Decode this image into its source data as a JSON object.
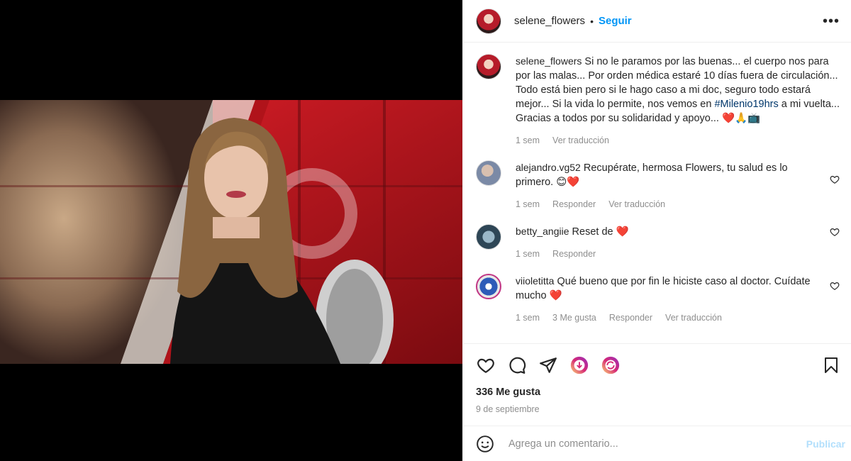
{
  "post": {
    "username": "selene_flowers",
    "follow_label": "Seguir",
    "more_label": "•••",
    "caption": "Si no le paramos por las buenas... el cuerpo nos para por las malas... Por orden médica estaré 10 días fuera de circulación... Todo está bien pero si le hago caso a mi doc, seguro todo estará mejor... Si la vida lo permite, nos vemos en",
    "caption_hashtag": "#Milenio19hrs",
    "caption_end": "a mi vuelta... Gracias a todos por su solidaridad y apoyo...",
    "caption_emojis": "❤️🙏📺",
    "caption_time": "1 sem",
    "caption_translate": "Ver traducción",
    "likes": "336 Me gusta",
    "date": "9 de septiembre"
  },
  "comments": [
    {
      "username": "alejandro.vg52",
      "text": "Recupérate, hermosa Flowers, tu salud es lo primero.",
      "emojis": "😊❤️",
      "time": "1 sem",
      "reply": "Responder",
      "translate": "Ver traducción"
    },
    {
      "username": "betty_angiie",
      "text": "Reset de",
      "emojis": "❤️",
      "time": "1 sem",
      "reply": "Responder"
    },
    {
      "username": "viioletitta",
      "text": "Qué bueno que por fin le hiciste caso al doctor. Cuídate mucho",
      "emojis": "❤️",
      "time": "1 sem",
      "likes": "3 Me gusta",
      "reply": "Responder",
      "translate": "Ver traducción"
    }
  ],
  "add_comment": {
    "placeholder": "Agrega un comentario...",
    "publish_label": "Publicar"
  },
  "icons": [
    "heart-icon",
    "comment-icon",
    "share-icon",
    "bookmark-icon",
    "emoji-icon"
  ]
}
